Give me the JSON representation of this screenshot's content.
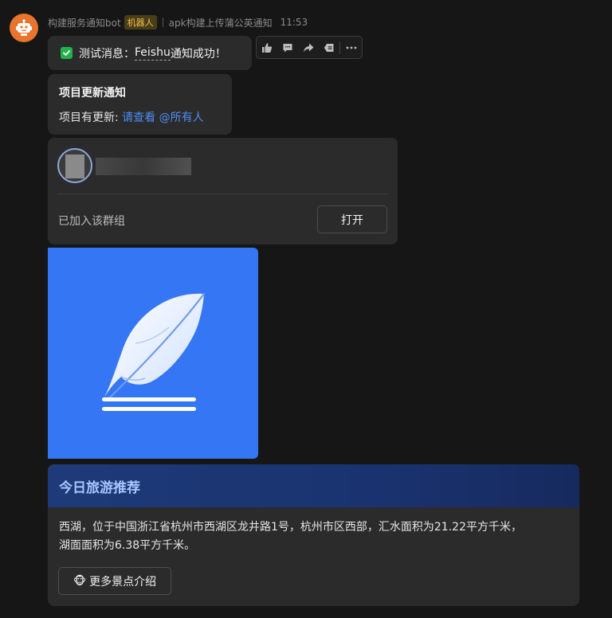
{
  "header": {
    "sender_name": "构建服务通知bot",
    "bot_badge": "机器人",
    "group_name": "apk构建上传蒲公英通知",
    "time": "11:53"
  },
  "message1": {
    "prefix": "测试消息：",
    "feishu": "Feishu",
    "suffix": " 通知成功！"
  },
  "toolbar": {
    "icons": [
      "thumbs-up-icon",
      "comment-icon",
      "forward-icon",
      "message-tag-icon",
      "more-icon"
    ]
  },
  "message2": {
    "title": "项目更新通知",
    "text": "项目有更新: ",
    "link1": "请查看",
    "link2": "@所有人"
  },
  "group_card": {
    "status": "已加入该群组",
    "open_label": "打开"
  },
  "travel_card": {
    "title": "今日旅游推荐",
    "line1": "西湖，位于中国浙江省杭州市西湖区龙井路1号，杭州市区西部，汇水面积为21.22平方千米，",
    "line2": "湖面面积为6.38平方千米。",
    "emoji": "🐵",
    "more_label": "更多景点介绍"
  },
  "colors": {
    "background": "#161616",
    "bubble": "#2b2b2b",
    "link": "#4f8df5",
    "image_blue": "#3476f4",
    "header_blue": "#1e3a78"
  }
}
